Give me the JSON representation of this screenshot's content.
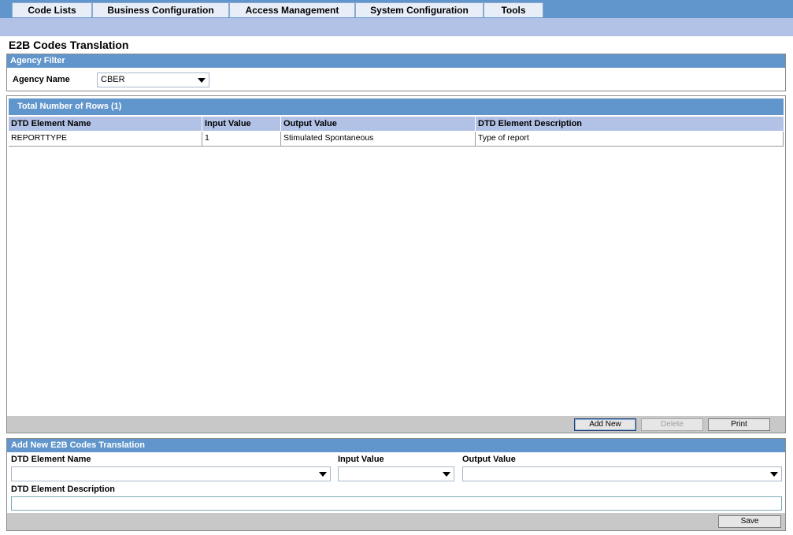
{
  "menu": {
    "items": [
      {
        "label": "Code Lists"
      },
      {
        "label": "Business Configuration"
      },
      {
        "label": "Access Management"
      },
      {
        "label": "System Configuration"
      },
      {
        "label": "Tools"
      }
    ]
  },
  "page": {
    "title": "E2B Codes Translation"
  },
  "agency_filter": {
    "header": "Agency Filter",
    "agency_name_label": "Agency Name",
    "agency_name_value": "CBER"
  },
  "results": {
    "header": "Total Number of Rows (1)",
    "columns": [
      "DTD Element Name",
      "Input Value",
      "Output Value",
      "DTD Element Description"
    ],
    "rows": [
      [
        "REPORTTYPE",
        "1",
        "Stimulated Spontaneous",
        "Type of report"
      ]
    ],
    "buttons": {
      "add_new": "Add New",
      "delete": "Delete",
      "print": "Print"
    }
  },
  "add_new": {
    "header": "Add New E2B Codes Translation",
    "dtd_element_name_label": "DTD Element Name",
    "input_value_label": "Input Value",
    "output_value_label": "Output Value",
    "dtd_element_description_label": "DTD Element Description",
    "save_label": "Save"
  },
  "colors": {
    "header_blue": "#6196cc",
    "subbar_blue": "#b2c2e6",
    "toolbar_gray": "#c8c8c8"
  }
}
